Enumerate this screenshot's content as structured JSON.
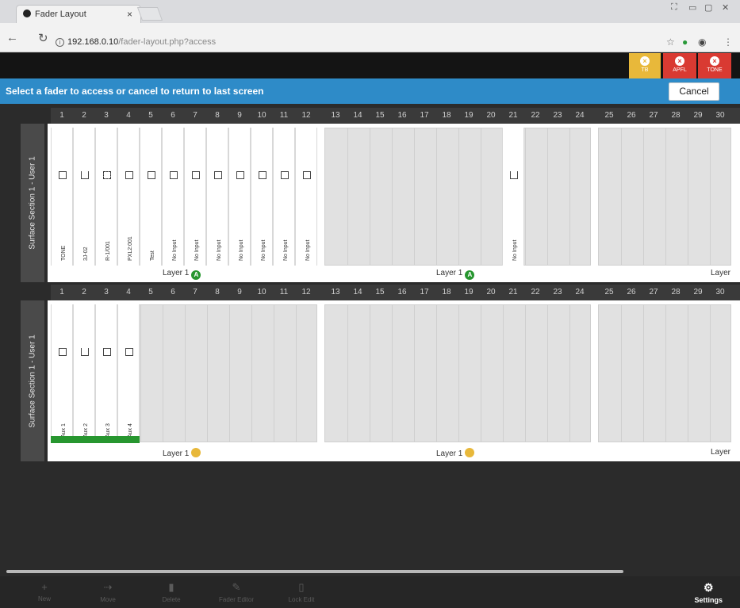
{
  "browser": {
    "tab_title": "Fader Layout",
    "tab_close": "×",
    "url_host": "192.168.0.10",
    "url_path": "/fader-layout.php?access"
  },
  "app": {
    "buttons": [
      {
        "label": "TB",
        "color": "#e8b83a"
      },
      {
        "label": "APFL",
        "color": "#d93a32"
      },
      {
        "label": "TONE",
        "color": "#d93a32"
      }
    ],
    "banner": "Select a fader to access or cancel to return to last screen",
    "cancel": "Cancel"
  },
  "numbers": [
    "1",
    "2",
    "3",
    "4",
    "5",
    "6",
    "7",
    "8",
    "9",
    "10",
    "11",
    "12",
    "13",
    "14",
    "15",
    "16",
    "17",
    "18",
    "19",
    "20",
    "21",
    "22",
    "23",
    "24",
    "25",
    "26",
    "27",
    "28",
    "29",
    "30"
  ],
  "sections": [
    {
      "side_label": "Surface Section 1 - User 1",
      "faders": [
        {
          "slot": 0,
          "label": "TONE",
          "icon": "closed"
        },
        {
          "slot": 1,
          "label": "3J-02",
          "icon": "open"
        },
        {
          "slot": 2,
          "label": "R-1/001",
          "icon": "grid"
        },
        {
          "slot": 3,
          "label": "PXL2:001",
          "icon": "closed"
        },
        {
          "slot": 4,
          "label": "Test",
          "icon": "closed"
        },
        {
          "slot": 5,
          "label": "No Input",
          "icon": "closed"
        },
        {
          "slot": 6,
          "label": "No Input",
          "icon": "closed"
        },
        {
          "slot": 7,
          "label": "No Input",
          "icon": "closed"
        },
        {
          "slot": 8,
          "label": "No Input",
          "icon": "closed"
        },
        {
          "slot": 9,
          "label": "No Input",
          "icon": "closed"
        },
        {
          "slot": 10,
          "label": "No Input",
          "icon": "closed"
        },
        {
          "slot": 11,
          "label": "No Input",
          "icon": "closed"
        },
        {
          "slot": 20,
          "label": "No Input",
          "icon": "open"
        }
      ],
      "layers": [
        {
          "text": "Layer 1",
          "badge": "A",
          "badge_color": "#27962f"
        },
        {
          "text": "Layer 1",
          "badge": "A",
          "badge_color": "#27962f"
        },
        {
          "text": "Layer",
          "badge": "",
          "badge_color": ""
        }
      ]
    },
    {
      "side_label": "Surface Section 1 - User 1",
      "faders": [
        {
          "slot": 0,
          "label": "Aux 1",
          "icon": "closed"
        },
        {
          "slot": 1,
          "label": "Aux 2",
          "icon": "open"
        },
        {
          "slot": 2,
          "label": "Aux 3",
          "icon": "closed"
        },
        {
          "slot": 3,
          "label": "Aux 4",
          "icon": "closed"
        }
      ],
      "layers": [
        {
          "text": "Layer 1",
          "badge": "",
          "badge_color": "#e8b83a"
        },
        {
          "text": "Layer 1",
          "badge": "",
          "badge_color": "#e8b83a"
        },
        {
          "text": "Layer",
          "badge": "",
          "badge_color": ""
        }
      ]
    }
  ],
  "bottom_toolbar": {
    "buttons": [
      "New",
      "Move",
      "Delete",
      "Fader Editor",
      "Lock Edit"
    ],
    "settings": "Settings"
  }
}
